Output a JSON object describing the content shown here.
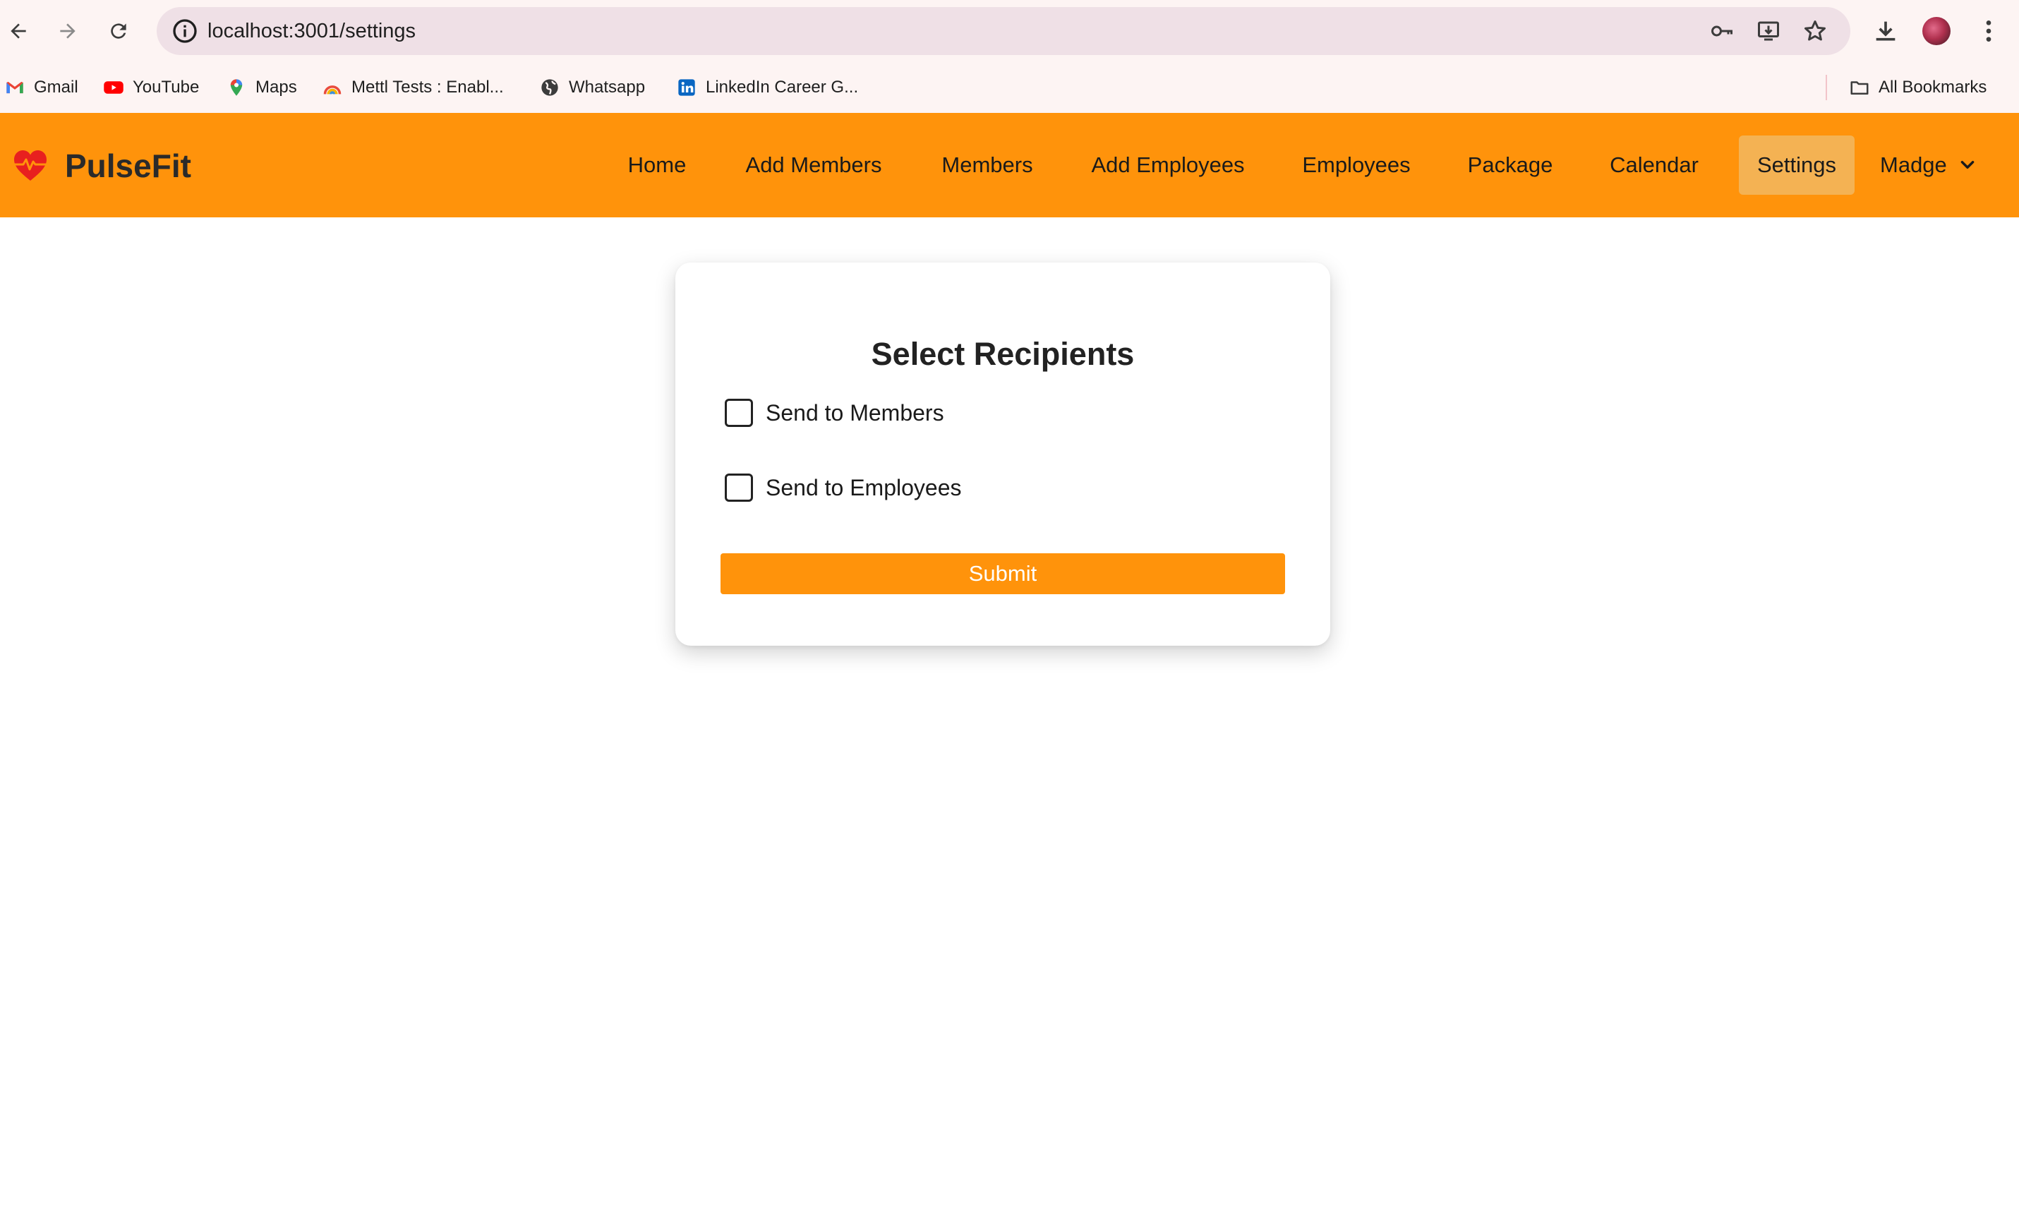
{
  "browser": {
    "url": "localhost:3001/settings",
    "bookmarks": [
      {
        "label": "Gmail",
        "icon": "gmail-icon"
      },
      {
        "label": "YouTube",
        "icon": "youtube-icon"
      },
      {
        "label": "Maps",
        "icon": "maps-icon"
      },
      {
        "label": "Mettl Tests : Enabl...",
        "icon": "mettl-icon"
      },
      {
        "label": "Whatsapp",
        "icon": "globe-icon"
      },
      {
        "label": "LinkedIn Career G...",
        "icon": "linkedin-icon"
      }
    ],
    "all_bookmarks": "All Bookmarks"
  },
  "app": {
    "brand": "PulseFit",
    "nav": [
      {
        "label": "Home",
        "active": false
      },
      {
        "label": "Add Members",
        "active": false
      },
      {
        "label": "Members",
        "active": false
      },
      {
        "label": "Add Employees",
        "active": false
      },
      {
        "label": "Employees",
        "active": false
      },
      {
        "label": "Package",
        "active": false
      },
      {
        "label": "Calendar",
        "active": false
      },
      {
        "label": "Settings",
        "active": true
      }
    ],
    "user": "Madge",
    "accent_color": "#ff930b"
  },
  "form": {
    "title": "Select Recipients",
    "options": [
      {
        "label": "Send to Members",
        "checked": false
      },
      {
        "label": "Send to Employees",
        "checked": false
      }
    ],
    "submit_label": "Submit"
  }
}
